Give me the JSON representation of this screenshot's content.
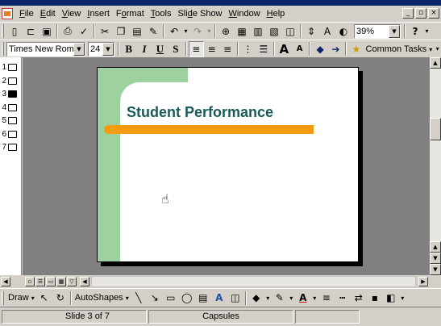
{
  "menubar": {
    "items": [
      {
        "pre": "",
        "u": "F",
        "post": "ile"
      },
      {
        "pre": "",
        "u": "E",
        "post": "dit"
      },
      {
        "pre": "",
        "u": "V",
        "post": "iew"
      },
      {
        "pre": "",
        "u": "I",
        "post": "nsert"
      },
      {
        "pre": "F",
        "u": "o",
        "post": "rmat"
      },
      {
        "pre": "",
        "u": "T",
        "post": "ools"
      },
      {
        "pre": "Sli",
        "u": "d",
        "post": "e Show"
      },
      {
        "pre": "",
        "u": "W",
        "post": "indow"
      },
      {
        "pre": "",
        "u": "H",
        "post": "elp"
      }
    ],
    "window_buttons": [
      "_",
      "▫",
      "×"
    ]
  },
  "standard_toolbar": {
    "zoom": "39%",
    "help_label": "?"
  },
  "formatting_toolbar": {
    "font": "Times New Roman",
    "size": "24",
    "bold": "B",
    "italic": "I",
    "underline": "U",
    "shadow": "S",
    "grow_font": "A",
    "shrink_font": "A",
    "common_tasks": "Common Tasks"
  },
  "outline": {
    "slides": [
      {
        "num": "1",
        "active": false
      },
      {
        "num": "2",
        "active": false
      },
      {
        "num": "3",
        "active": true
      },
      {
        "num": "4",
        "active": false
      },
      {
        "num": "5",
        "active": false
      },
      {
        "num": "6",
        "active": false
      },
      {
        "num": "7",
        "active": false
      }
    ]
  },
  "slide": {
    "title": "Student Performance",
    "green_color": "#9fd09f",
    "title_color": "#1a5a5a",
    "bar_color": "#f39c12"
  },
  "drawing_toolbar": {
    "draw": "Draw",
    "autoshapes": "AutoShapes"
  },
  "statusbar": {
    "slide_position": "Slide 3 of 7",
    "design": "Capsules"
  }
}
